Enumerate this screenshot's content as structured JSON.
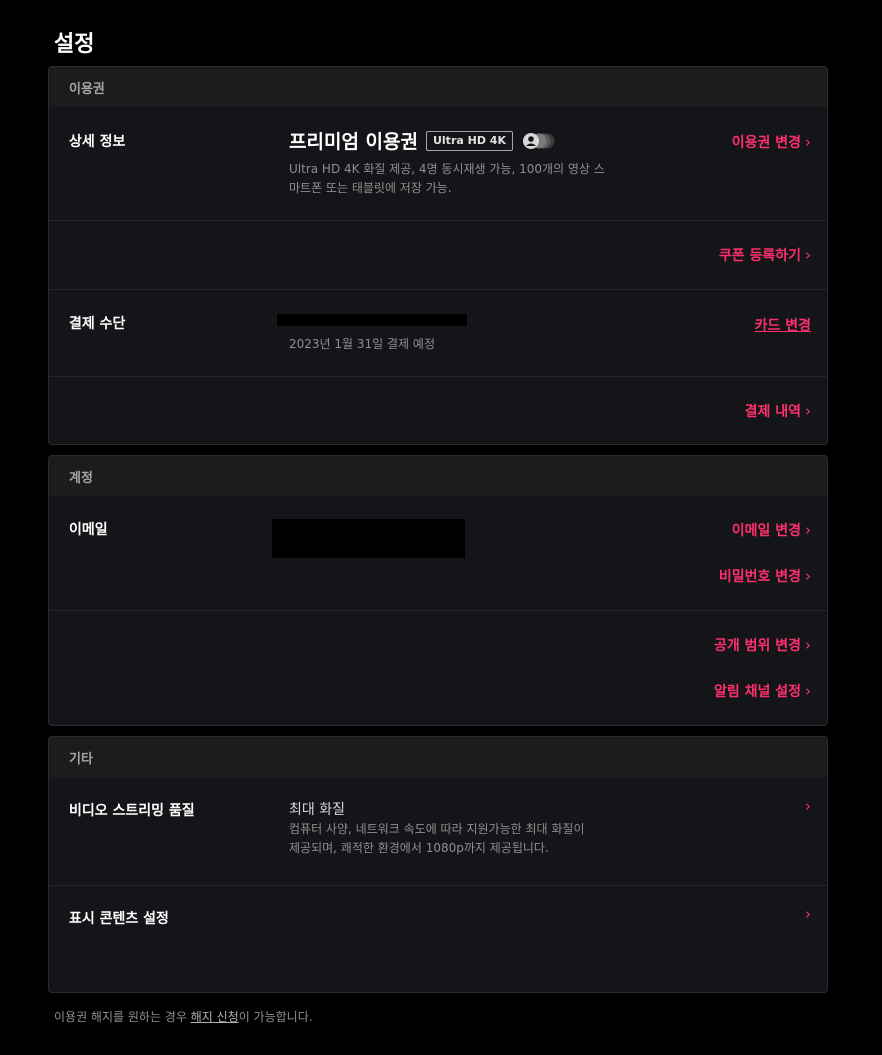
{
  "page": {
    "title": "설정"
  },
  "membership": {
    "header": "이용권",
    "detail_label": "상세 정보",
    "plan_title": "프리미엄 이용권",
    "plan_badge": "Ultra HD 4K",
    "plan_desc_line1": "Ultra HD 4K 화질 제공, 4명 동시재생 가능, 100개의 영상 스",
    "plan_desc_line2": "마트폰 또는 태블릿에 저장 가능.",
    "change_plan": "이용권 변경",
    "coupon": "쿠폰 등록하기",
    "payment_label": "결제 수단",
    "payment_date": "2023년 1월 31일 결제 예정",
    "change_card": "카드 변경",
    "payment_history": "결제 내역"
  },
  "account": {
    "header": "계정",
    "email_label": "이메일",
    "change_email": "이메일 변경",
    "change_password": "비밀번호 변경",
    "change_privacy": "공개 범위 변경",
    "notification_settings": "알림 채널 설정"
  },
  "other": {
    "header": "기타",
    "quality_label": "비디오 스트리밍 품질",
    "quality_value": "최대 화질",
    "quality_desc_line1": "컴퓨터 사양, 네트워크 속도에 따라 지원가능한 최대 화질이",
    "quality_desc_line2": "제공되며, 쾌적한 환경에서 1080p까지 제공됩니다.",
    "display_content_label": "표시 콘텐츠 설정"
  },
  "footer": {
    "prefix": "이용권 해지를 원하는 경우 ",
    "link": "해지 신청",
    "suffix": "이 가능합니다."
  },
  "icons": {
    "chevron": "chevron-right-icon",
    "screens": "profile-screens-icon"
  },
  "colors": {
    "accent": "#ff2f6e",
    "background": "#000000",
    "panel": "#141518",
    "panel_header": "#1c1c1f"
  }
}
